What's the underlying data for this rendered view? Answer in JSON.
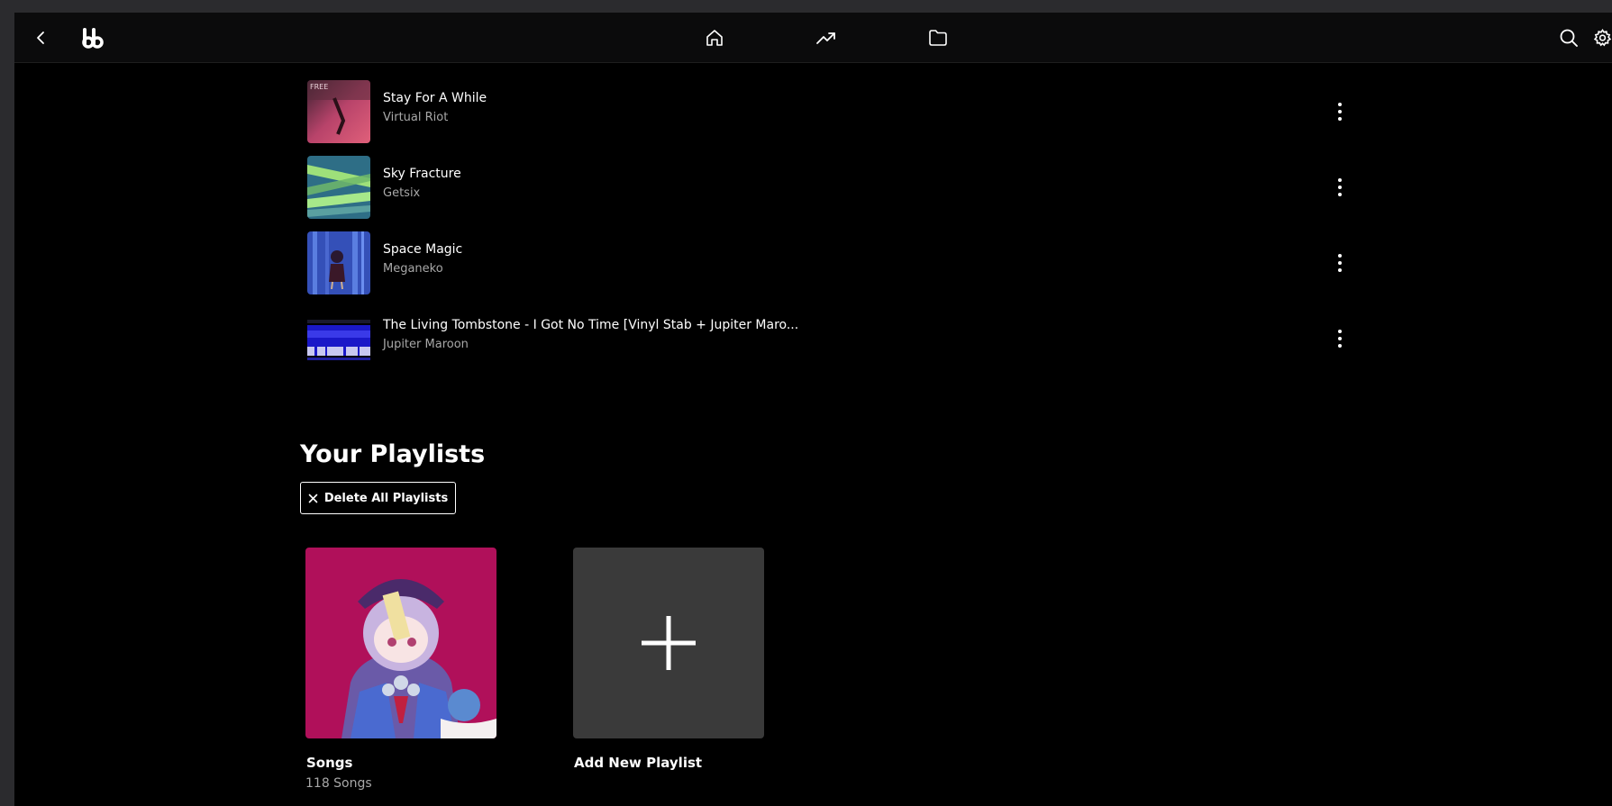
{
  "header": {
    "icons": [
      "back-icon",
      "app-logo",
      "home-icon",
      "trending-icon",
      "folder-icon",
      "search-icon",
      "settings-icon"
    ]
  },
  "tracks": [
    {
      "title": "Stay For A While",
      "artist": "Virtual Riot"
    },
    {
      "title": "Sky Fracture",
      "artist": "Getsix"
    },
    {
      "title": "Space Magic",
      "artist": "Meganeko"
    },
    {
      "title": "The Living Tombstone - I Got No Time [Vinyl Stab + Jupiter Maro...",
      "artist": "Jupiter Maroon"
    }
  ],
  "playlists_section": {
    "title": "Your Playlists",
    "delete_all_label": "Delete All Playlists",
    "cards": [
      {
        "name": "Songs",
        "subtitle": "118 Songs"
      },
      {
        "name": "Add New Playlist"
      }
    ]
  },
  "colors": {
    "background": "#000000",
    "header": "#0b0b0c",
    "secondary_text": "#a8a8a8",
    "add_tile": "#3a3a3a"
  }
}
